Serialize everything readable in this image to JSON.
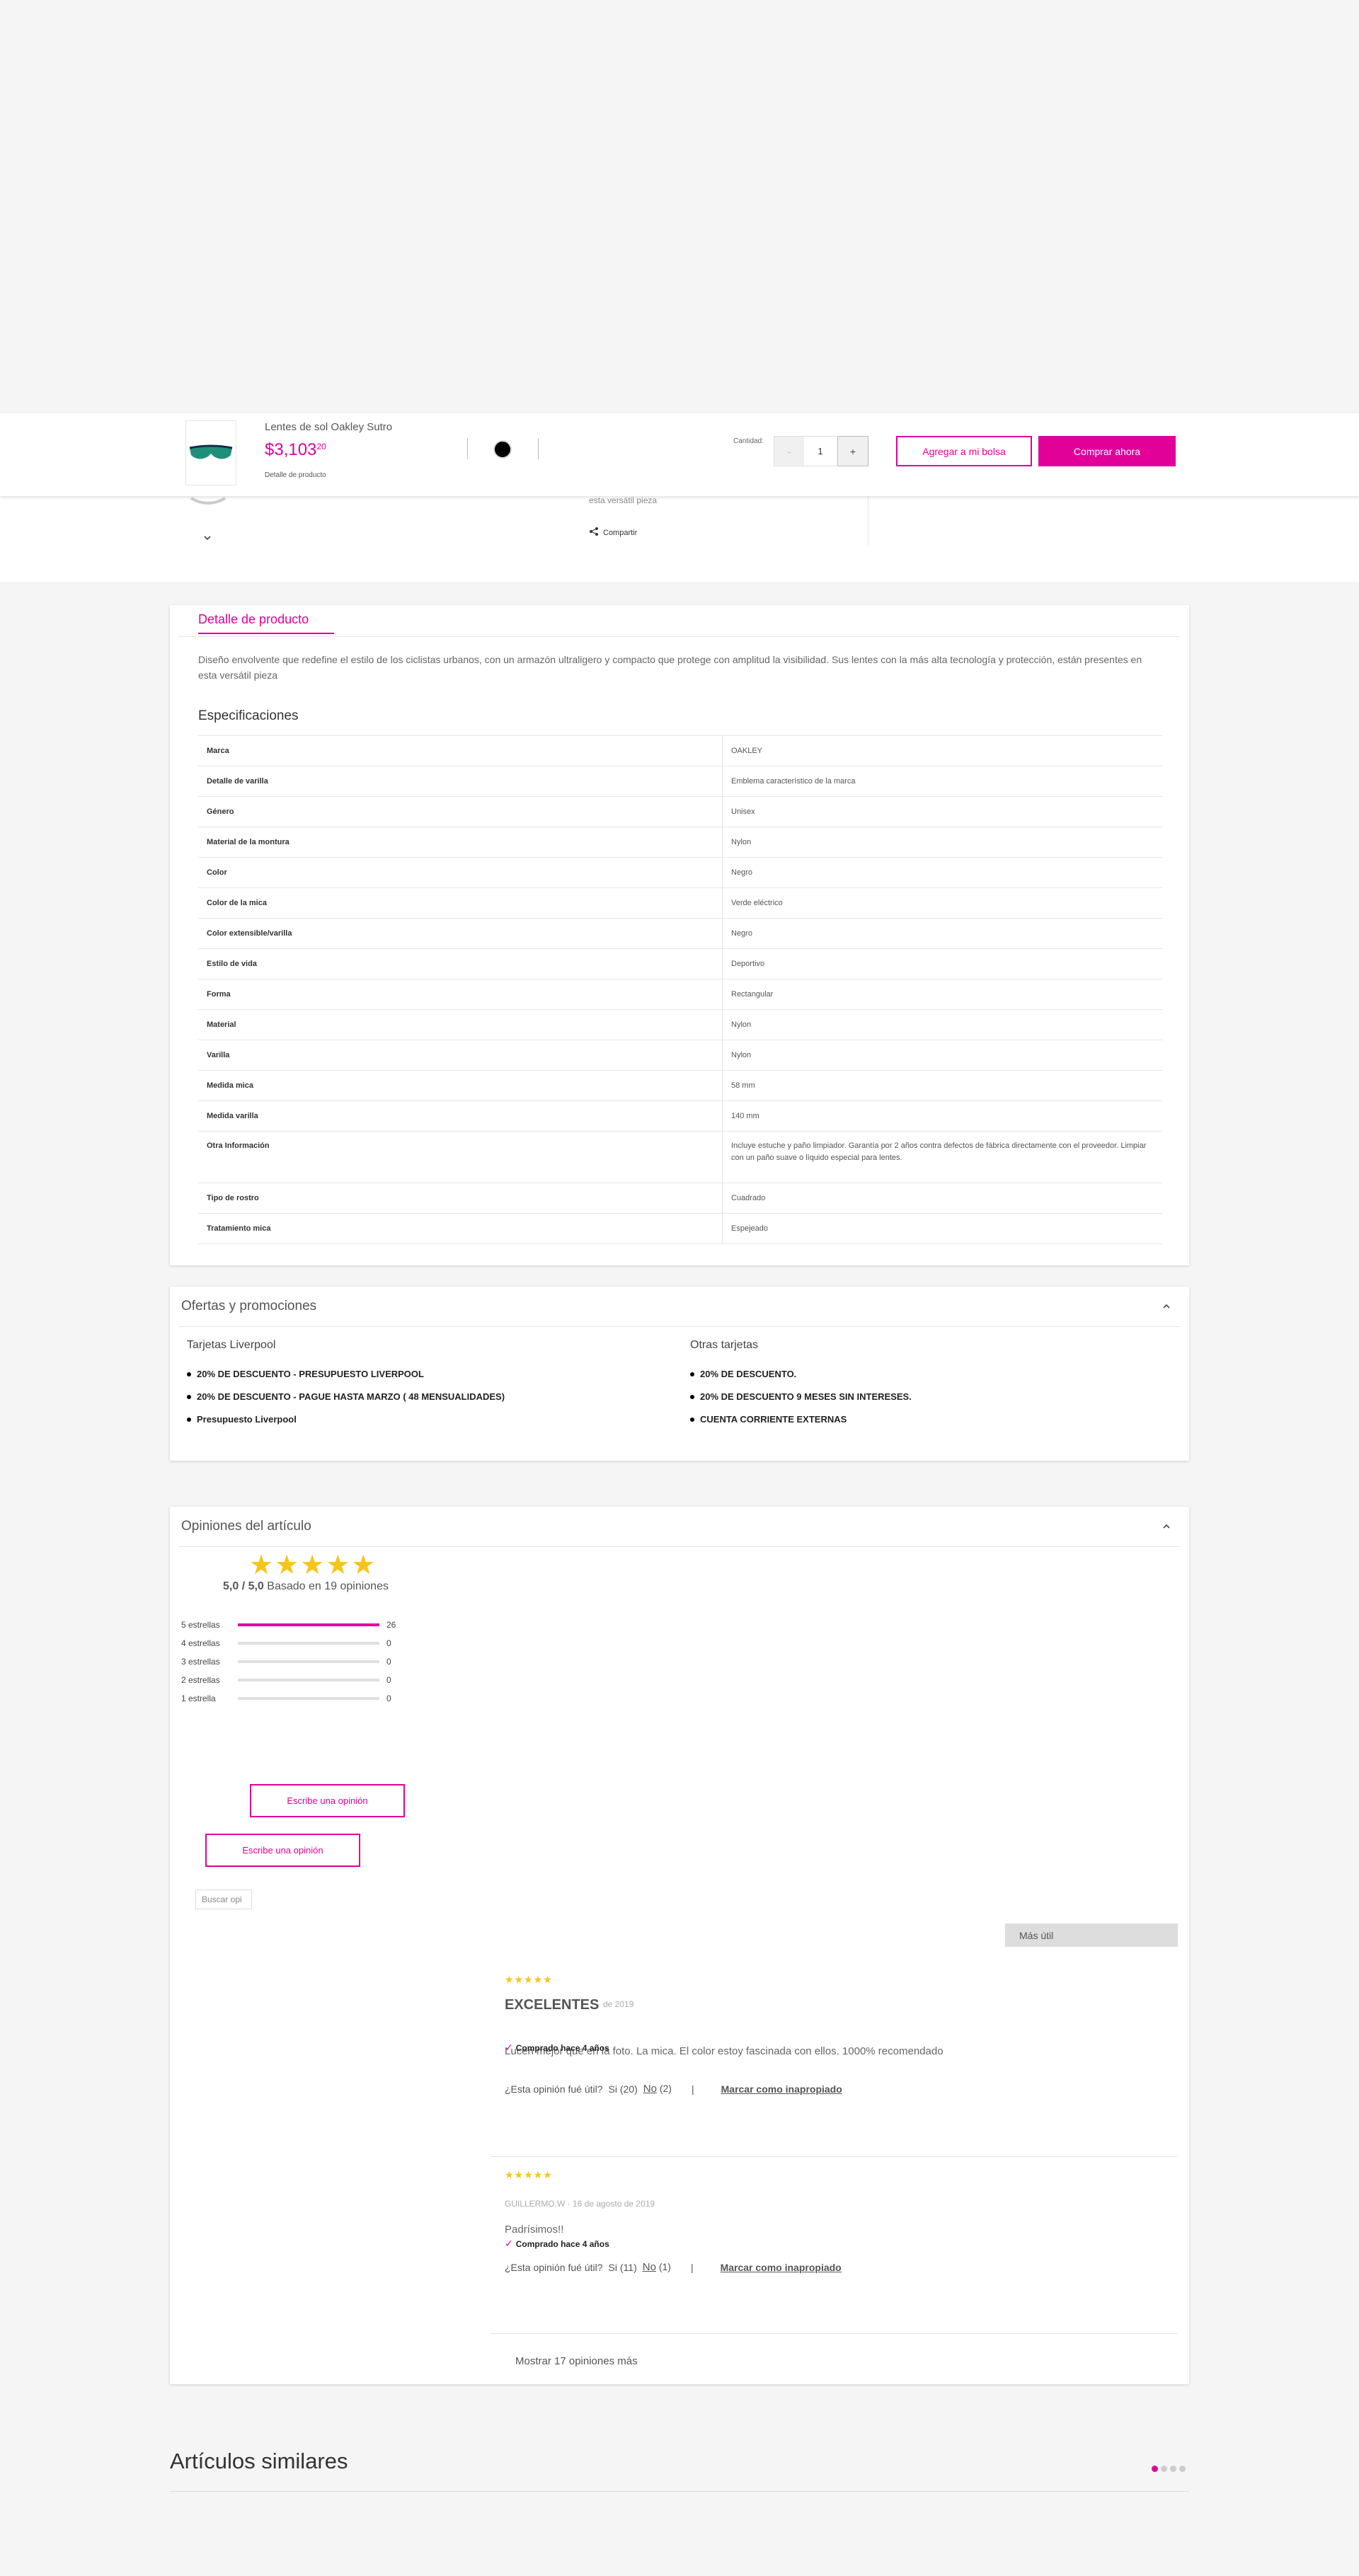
{
  "sticky": {
    "product_name": "Lentes de sol Oakley Sutro",
    "price_main": "$3,103",
    "price_cents": "20",
    "detail_link": "Detalle de producto",
    "qty_label": "Cantidad:",
    "qty_minus": "-",
    "qty_value": "1",
    "qty_plus": "+",
    "add_to_bag": "Agregar a mi bolsa",
    "buy_now": "Comprar ahora"
  },
  "topband": {
    "desc_fragment": "esta versátil pieza",
    "share": "Compartir"
  },
  "detalle": {
    "tab": "Detalle de producto",
    "description": "Diseño envolvente que redefine el estilo de los ciclistas urbanos, con un armazón ultraligero y compacto que protege con amplitud la visibilidad. Sus lentes con la más alta tecnología y protección, están presentes en esta versátil pieza",
    "spec_heading": "Especificaciones",
    "specs": [
      {
        "k": "Marca",
        "v": "OAKLEY"
      },
      {
        "k": "Detalle de varilla",
        "v": "Emblema característico de la marca"
      },
      {
        "k": "Género",
        "v": "Unisex"
      },
      {
        "k": "Material de la montura",
        "v": "Nylon"
      },
      {
        "k": "Color",
        "v": "Negro"
      },
      {
        "k": "Color de la mica",
        "v": "Verde eléctrico"
      },
      {
        "k": "Color extensible/varilla",
        "v": "Negro"
      },
      {
        "k": "Estilo de vida",
        "v": "Deportivo"
      },
      {
        "k": "Forma",
        "v": "Rectangular"
      },
      {
        "k": "Material",
        "v": "Nylon"
      },
      {
        "k": "Varilla",
        "v": "Nylon"
      },
      {
        "k": "Medida mica",
        "v": "58 mm"
      },
      {
        "k": "Medida varilla",
        "v": "140 mm"
      },
      {
        "k": "Otra Información",
        "v": "Incluye estuche y paño limpiador. Garantía por 2 años contra defectos de fábrica directamente con el proveedor. Limpiar con un paño suave o líquido especial para lentes."
      },
      {
        "k": "Tipo de rostro",
        "v": "Cuadrado"
      },
      {
        "k": "Tratamiento mica",
        "v": "Espejeado"
      }
    ]
  },
  "ofertas": {
    "title": "Ofertas y promociones",
    "col1_title": "Tarjetas Liverpool",
    "col1": [
      "20% DE DESCUENTO - PRESUPUESTO LIVERPOOL",
      "20% DE DESCUENTO - PAGUE HASTA MARZO ( 48 MENSUALIDADES)",
      "Presupuesto Liverpool"
    ],
    "col2_title": "Otras tarjetas",
    "col2": [
      "20% DE DESCUENTO.",
      "20% DE DESCUENTO 9 MESES SIN INTERESES.",
      "CUENTA CORRIENTE EXTERNAS"
    ]
  },
  "opiniones": {
    "title": "Opiniones del artículo",
    "stars": "★★★★★",
    "score": "5,0 / 5,0",
    "based_on": "Basado en 19 opiniones",
    "bars": [
      {
        "label": "5 estrellas",
        "count": "26",
        "fill": 1.0
      },
      {
        "label": "4 estrellas",
        "count": "0",
        "fill": 0
      },
      {
        "label": "3 estrellas",
        "count": "0",
        "fill": 0
      },
      {
        "label": "2 estrellas",
        "count": "0",
        "fill": 0
      },
      {
        "label": "1 estrella",
        "count": "0",
        "fill": 0
      }
    ],
    "write_btn": "Escribe una opinión",
    "search_placeholder": "Buscar opi",
    "sort": "Más útil",
    "reviews": [
      {
        "stars": "★★★★★",
        "title": "EXCELENTES",
        "meta": "de 2019",
        "body": "Lucen mejor que en la foto. La mica. El color estoy fascinada con ellos. 1000% recomendado",
        "bought": "Comprado hace 4 años",
        "question": "¿Esta opinión fué útil?",
        "yes": "Si",
        "yes_count": "(20)",
        "no": "No",
        "no_count": "(2)",
        "sep": "|",
        "flag": "Marcar como inapropiado"
      },
      {
        "stars": "★★★★★",
        "meta": "GUILLERMO.W · 16 de agosto de 2019",
        "body": "Padrísimos!!",
        "bought": "Comprado hace 4 años",
        "question": "¿Esta opinión fué útil?",
        "yes": "Si",
        "yes_count": "(11)",
        "no": "No",
        "no_count": "(1)",
        "sep": "|",
        "flag": "Marcar como inapropiado"
      }
    ],
    "more": "Mostrar 17 opiniones más"
  },
  "similares": {
    "title": "Artículos similares"
  },
  "colors": {
    "accent": "#e10098",
    "star": "#f5c518"
  }
}
